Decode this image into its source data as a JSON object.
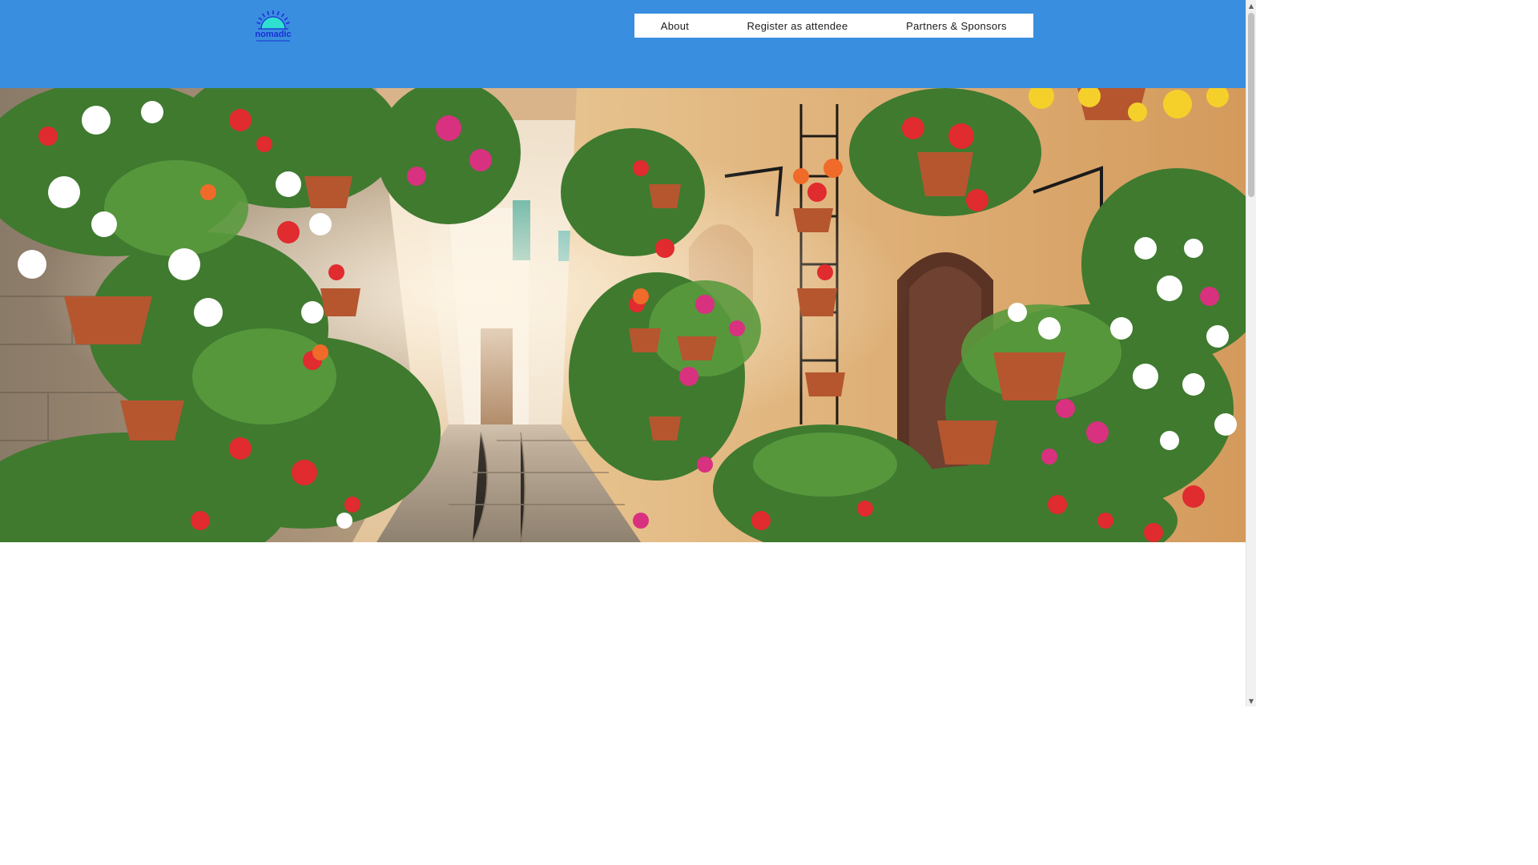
{
  "header": {
    "background_color": "#3a8ee0",
    "logo": {
      "text": "nomadic",
      "icon": "sunrise-logo-icon"
    }
  },
  "nav": {
    "items": [
      {
        "label": "About"
      },
      {
        "label": "Register as attendee"
      },
      {
        "label": "Partners & Sponsors"
      }
    ]
  },
  "hero": {
    "image": "flower-alley-photo"
  },
  "scrollbar": {
    "up_icon": "▲",
    "down_icon": "▼"
  }
}
